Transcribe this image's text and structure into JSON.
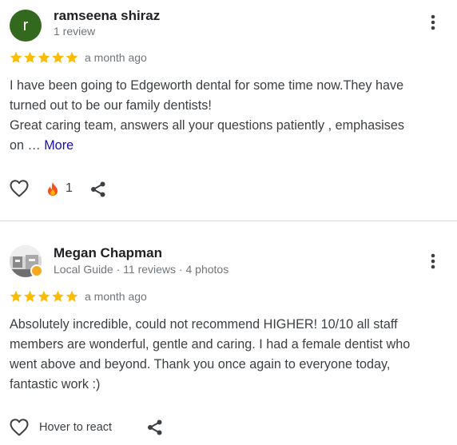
{
  "reviews": [
    {
      "reviewer_name": "ramseena shiraz",
      "avatar_letter": "r",
      "reviewer_meta": "1 review",
      "rating": 5,
      "time": "a month ago",
      "text_lines": [
        "I have been going to Edgeworth dental for some time now.They have",
        "turned out to be our family dentists!",
        "Great caring team, answers all your questions patiently , emphasises",
        "on … "
      ],
      "more_label": "More",
      "reaction_count": "1"
    },
    {
      "reviewer_name": "Megan Chapman",
      "reviewer_meta": "Local Guide · 11 reviews · 4 photos",
      "rating": 5,
      "time": "a month ago",
      "text_lines": [
        "Absolutely incredible, could not recommend HIGHER! 10/10 all staff",
        "members are wonderful, gentle and caring. I had a female dentist who",
        "went above and beyond. Thank you once again to everyone today,",
        "fantastic work :)"
      ],
      "react_label": "Hover to react"
    }
  ],
  "colors": {
    "star": "#fbbc04",
    "avatar_bg": "#33691e",
    "link": "#1a0dab",
    "fire": "#f4511e",
    "local_guide_badge": "#f6a821"
  },
  "icons": [
    "person-avatar",
    "star-icon",
    "more-vert-icon",
    "heart-outline-icon",
    "fire-emoji-icon",
    "share-icon",
    "local-guide-badge-icon"
  ]
}
